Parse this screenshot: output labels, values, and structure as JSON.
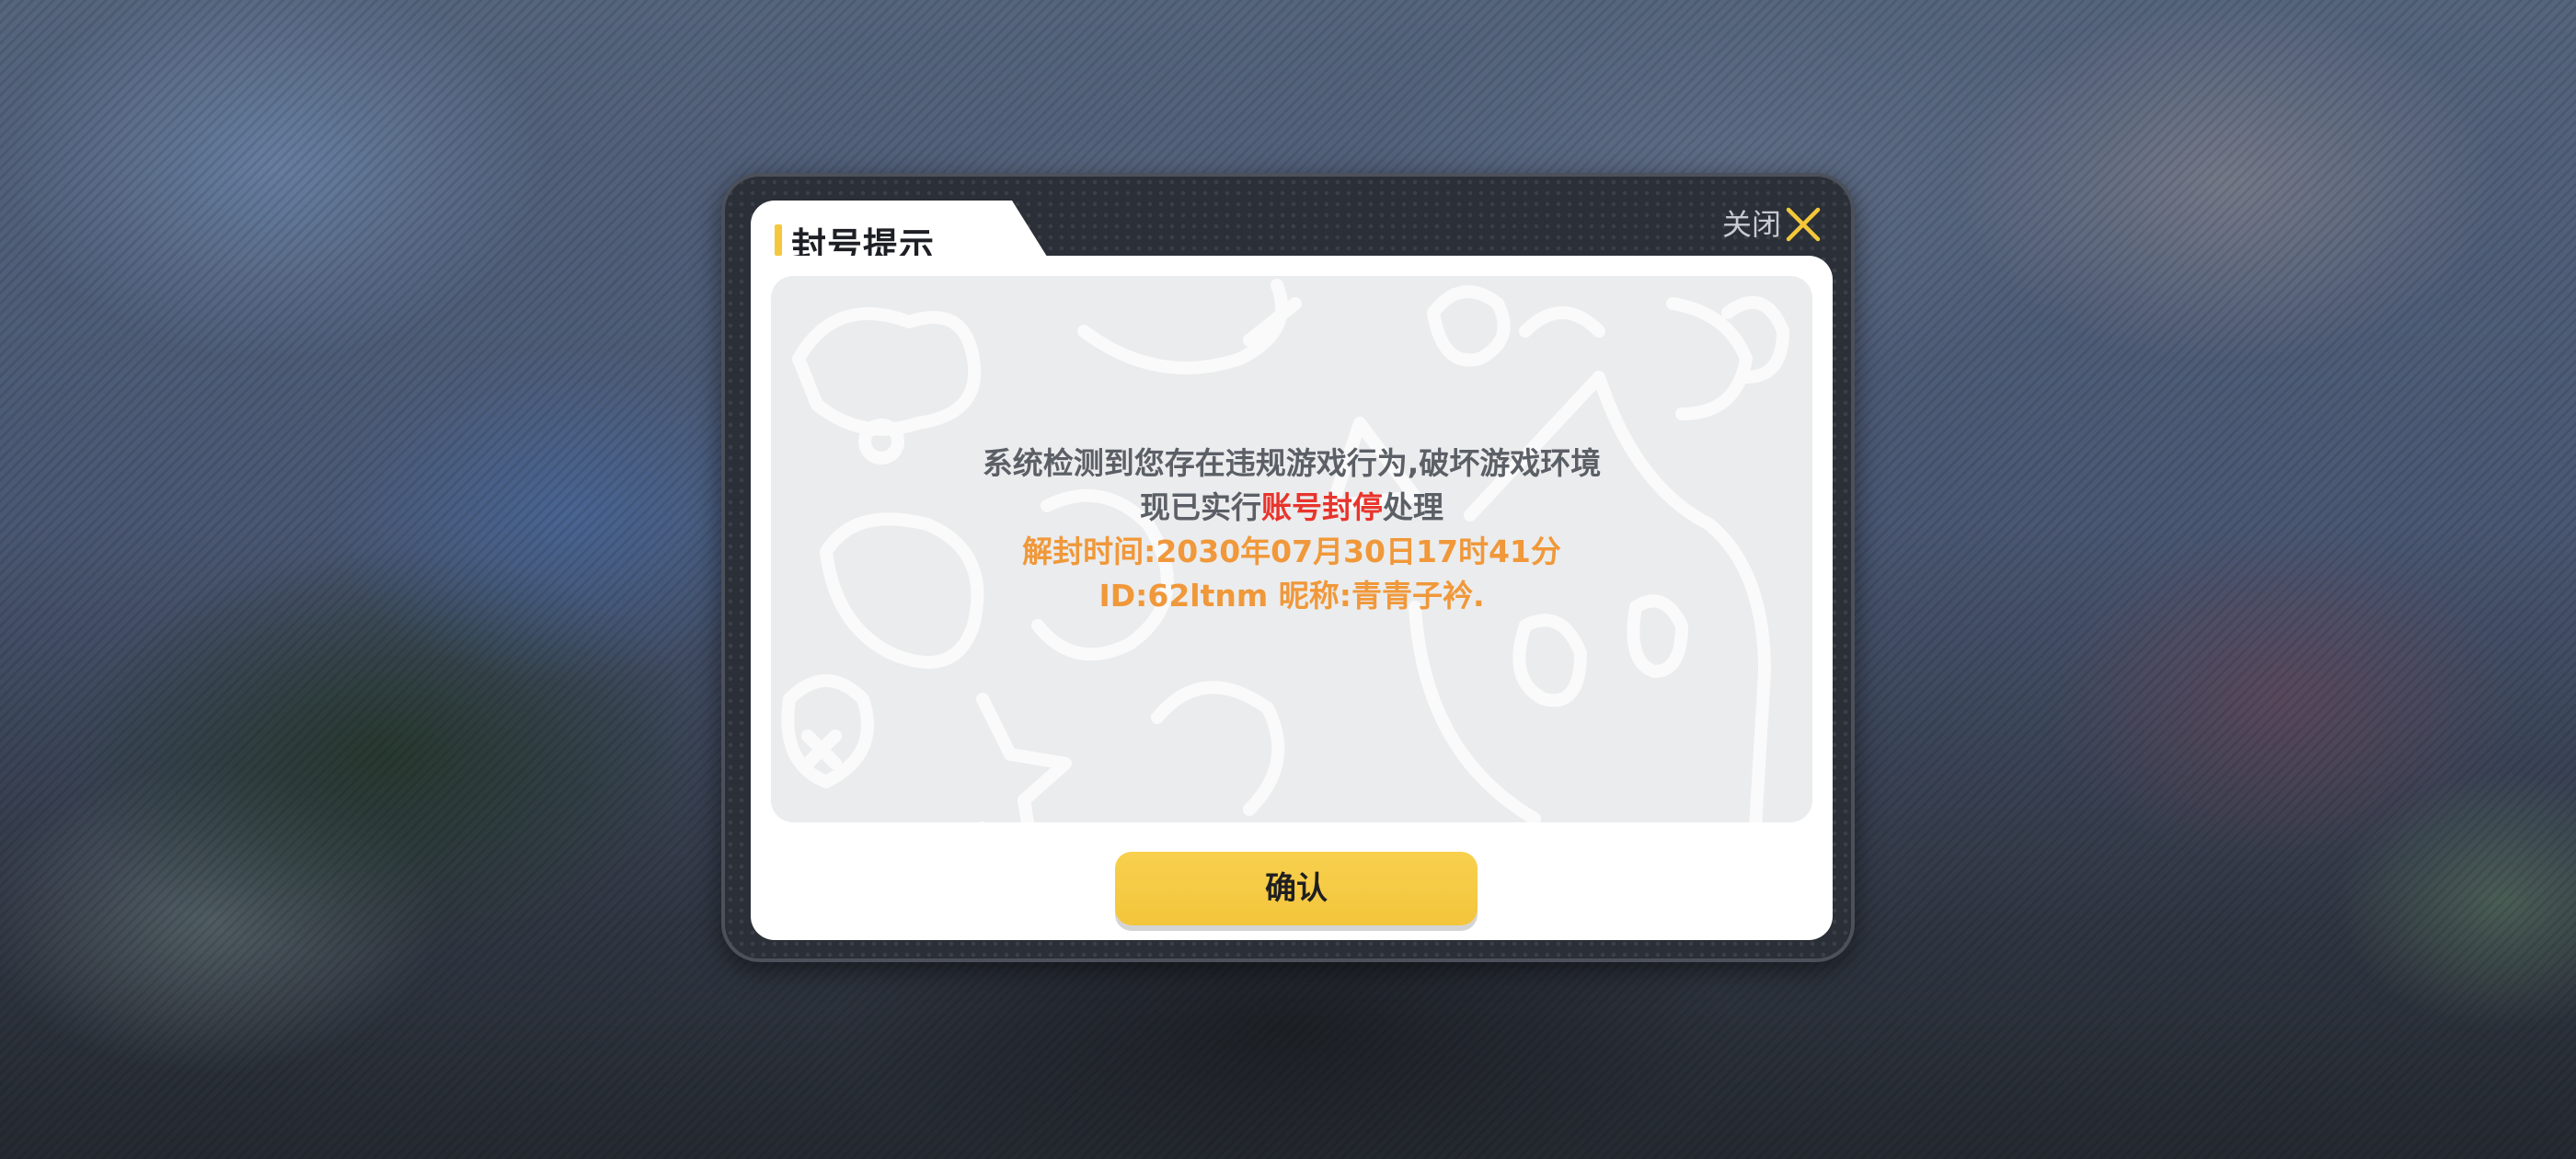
{
  "dialog": {
    "title": "封号提示",
    "close_label": "关闭",
    "message": {
      "line1": "系统检测到您存在违规游戏行为,破坏游戏环境",
      "line2_prefix": "现已实行",
      "line2_highlight": "账号封停",
      "line2_suffix": "处理",
      "unban_label": "解封时间:",
      "unban_time": "2030年07月30日17时41分",
      "id_label": "ID:",
      "id_value": "62ltnm",
      "nickname_label": "昵称:",
      "nickname_value": "青青子衿."
    },
    "confirm_label": "确认"
  },
  "colors": {
    "accent_yellow": "#f4c83a",
    "warning_red": "#e8342c",
    "info_orange": "#f0983a",
    "frame_dark": "#2b2f37"
  },
  "icons": [
    "close-icon"
  ]
}
